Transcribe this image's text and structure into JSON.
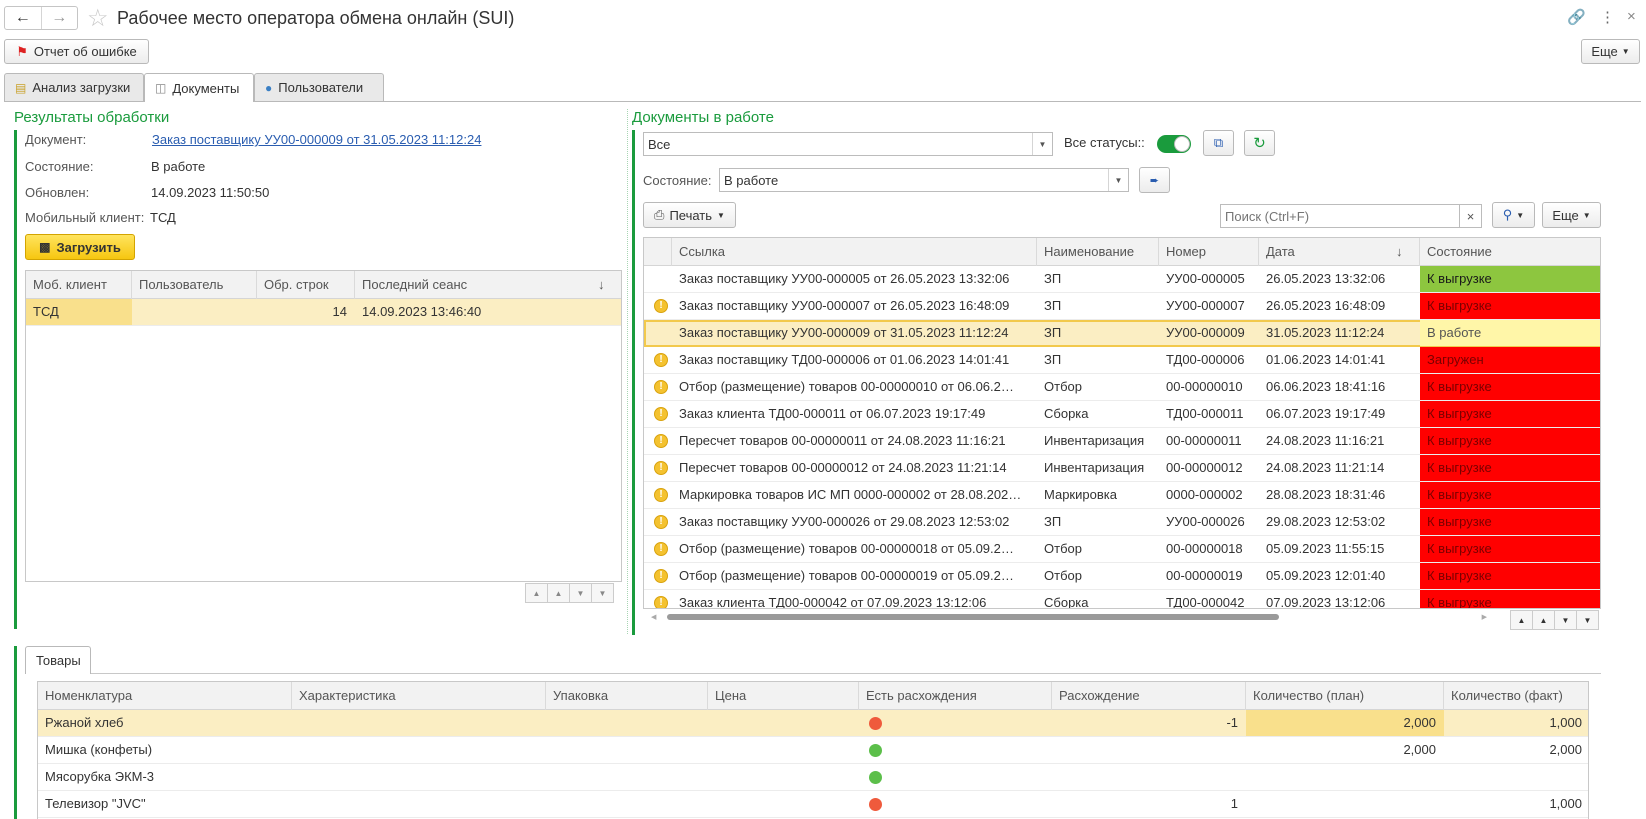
{
  "window": {
    "title": "Рабочее место оператора обмена онлайн (SUI)"
  },
  "toolbar": {
    "report_label": "Отчет об ошибке",
    "more_label": "Еще"
  },
  "tabs": [
    {
      "label": "Анализ загрузки"
    },
    {
      "label": "Документы"
    },
    {
      "label": "Пользователи"
    }
  ],
  "results": {
    "title": "Результаты обработки",
    "document_label": "Документ:",
    "document_value": "Заказ поставщику УУ00-000009 от 31.05.2023 11:12:24",
    "state_label": "Состояние:",
    "state_value": "В работе",
    "updated_label": "Обновлен:",
    "updated_value": "14.09.2023 11:50:50",
    "client_label": "Мобильный клиент:",
    "client_value": "ТСД",
    "load_button": "Загрузить",
    "table": {
      "headers": [
        "Моб. клиент",
        "Пользователь",
        "Обр. строк",
        "Последний сеанс"
      ],
      "rows": [
        {
          "client": "ТСД",
          "user": "",
          "rows": "14",
          "session": "14.09.2023 13:46:40"
        }
      ]
    }
  },
  "docs": {
    "title": "Документы в работе",
    "filter_value": "Все",
    "all_statuses_label": "Все статусы::",
    "state_label": "Состояние:",
    "state_value": "В работе",
    "print_label": "Печать",
    "search_placeholder": "Поиск (Ctrl+F)",
    "more_label": "Еще",
    "headers": [
      "Ссылка",
      "Наименование",
      "Номер",
      "Дата",
      "Состояние"
    ],
    "rows": [
      {
        "ref": "Заказ поставщику УУ00-000005 от 26.05.2023 13:32:06",
        "name": "ЗП",
        "num": "УУ00-000005",
        "date": "26.05.2023 13:32:06",
        "state": "К выгрузке",
        "color": "#8dc63f",
        "warn": false
      },
      {
        "ref": "Заказ поставщику УУ00-000007 от 26.05.2023 16:48:09",
        "name": "ЗП",
        "num": "УУ00-000007",
        "date": "26.05.2023 16:48:09",
        "state": "К выгрузке",
        "color": "#ff0000",
        "warn": true
      },
      {
        "ref": "Заказ поставщику УУ00-000009 от 31.05.2023 11:12:24",
        "name": "ЗП",
        "num": "УУ00-000009",
        "date": "31.05.2023 11:12:24",
        "state": "В работе",
        "color": "#fff6a8",
        "warn": false
      },
      {
        "ref": "Заказ поставщику ТД00-000006 от 01.06.2023 14:01:41",
        "name": "ЗП",
        "num": "ТД00-000006",
        "date": "01.06.2023 14:01:41",
        "state": "Загружен",
        "color": "#ff0000",
        "warn": true
      },
      {
        "ref": "Отбор (размещение) товаров 00-00000010 от 06.06.2…",
        "name": "Отбор",
        "num": "00-00000010",
        "date": "06.06.2023 18:41:16",
        "state": "К выгрузке",
        "color": "#ff0000",
        "warn": true
      },
      {
        "ref": "Заказ клиента ТД00-000011 от 06.07.2023 19:17:49",
        "name": "Сборка",
        "num": "ТД00-000011",
        "date": "06.07.2023 19:17:49",
        "state": "К выгрузке",
        "color": "#ff0000",
        "warn": true
      },
      {
        "ref": "Пересчет товаров 00-00000011 от 24.08.2023 11:16:21",
        "name": "Инвентаризация",
        "num": "00-00000011",
        "date": "24.08.2023 11:16:21",
        "state": "К выгрузке",
        "color": "#ff0000",
        "warn": true
      },
      {
        "ref": "Пересчет товаров 00-00000012 от 24.08.2023 11:21:14",
        "name": "Инвентаризация",
        "num": "00-00000012",
        "date": "24.08.2023 11:21:14",
        "state": "К выгрузке",
        "color": "#ff0000",
        "warn": true
      },
      {
        "ref": "Маркировка товаров ИС МП 0000-000002 от 28.08.202…",
        "name": "Маркировка",
        "num": "0000-000002",
        "date": "28.08.2023 18:31:46",
        "state": "К выгрузке",
        "color": "#ff0000",
        "warn": true
      },
      {
        "ref": "Заказ поставщику УУ00-000026 от 29.08.2023 12:53:02",
        "name": "ЗП",
        "num": "УУ00-000026",
        "date": "29.08.2023 12:53:02",
        "state": "К выгрузке",
        "color": "#ff0000",
        "warn": true
      },
      {
        "ref": "Отбор (размещение) товаров 00-00000018 от 05.09.2…",
        "name": "Отбор",
        "num": "00-00000018",
        "date": "05.09.2023 11:55:15",
        "state": "К выгрузке",
        "color": "#ff0000",
        "warn": true
      },
      {
        "ref": "Отбор (размещение) товаров 00-00000019 от 05.09.2…",
        "name": "Отбор",
        "num": "00-00000019",
        "date": "05.09.2023 12:01:40",
        "state": "К выгрузке",
        "color": "#ff0000",
        "warn": true
      },
      {
        "ref": "Заказ клиента ТД00-000042 от 07.09.2023 13:12:06",
        "name": "Сборка",
        "num": "ТД00-000042",
        "date": "07.09.2023 13:12:06",
        "state": "К выгрузке",
        "color": "#ff0000",
        "warn": true
      }
    ]
  },
  "goods": {
    "tab_label": "Товары",
    "headers": [
      "Номенклатура",
      "Характеристика",
      "Упаковка",
      "Цена",
      "Есть расхождения",
      "Расхождение",
      "Количество (план)",
      "Количество (факт)"
    ],
    "rows": [
      {
        "name": "Ржаной хлеб",
        "char": "",
        "pack": "",
        "price": "",
        "dot": "#ef5a3c",
        "diff": "-1",
        "plan": "2,000",
        "fact": "1,000"
      },
      {
        "name": "Мишка (конфеты)",
        "char": "",
        "pack": "",
        "price": "",
        "dot": "#5cbf4a",
        "diff": "",
        "plan": "2,000",
        "fact": "2,000"
      },
      {
        "name": "Мясорубка ЭКМ-3",
        "char": "",
        "pack": "",
        "price": "",
        "dot": "#5cbf4a",
        "diff": "",
        "plan": "",
        "fact": ""
      },
      {
        "name": "Телевизор \"JVC\"",
        "char": "",
        "pack": "",
        "price": "",
        "dot": "#ef5a3c",
        "diff": "1",
        "plan": "",
        "fact": "1,000"
      }
    ]
  }
}
